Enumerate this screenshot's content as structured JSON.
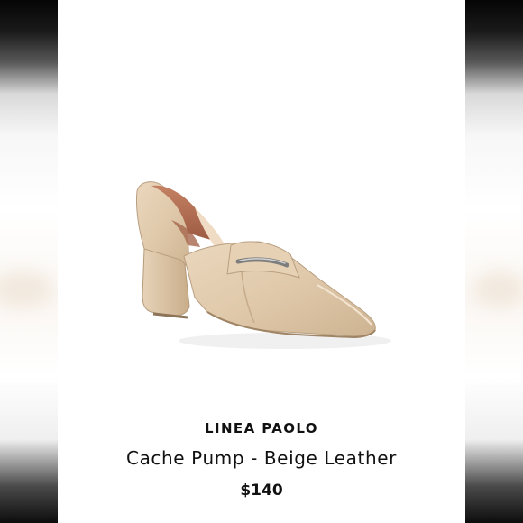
{
  "product": {
    "brand": "LINEA PAOLO",
    "name": "Cache Pump - Beige Leather",
    "price": "$140",
    "image": "beige-leather-pointed-toe-pump"
  },
  "colors": {
    "background": "#ffffff",
    "text": "#111111",
    "leather": "#e0c9ab",
    "leather_shadow": "#b99f80",
    "lining": "#b87055",
    "hardware": "#8f8f8f"
  }
}
